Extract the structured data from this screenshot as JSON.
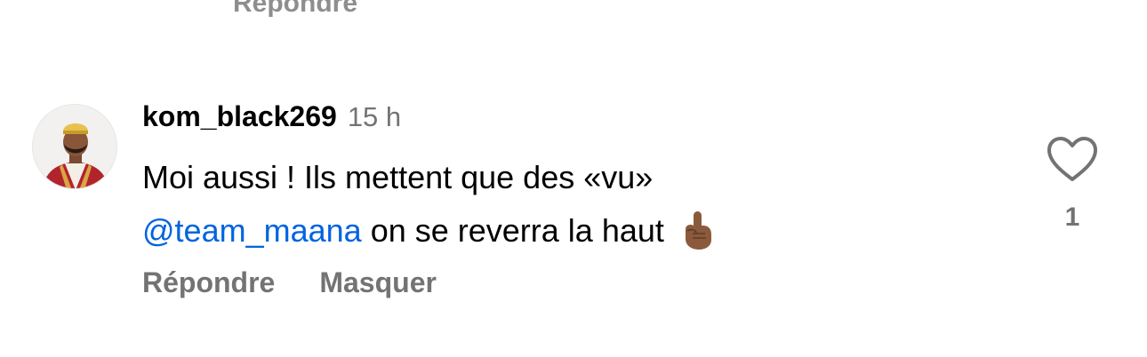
{
  "previous_comment": {
    "reply_label": "Répondre"
  },
  "comment": {
    "username": "kom_black269",
    "time_ago": "15 h",
    "text_line1": "Moi aussi ! Ils mettent que des «vu»",
    "mention": "@team_maana",
    "text_line2": "on se reverra la haut",
    "emoji": "pointing-up-emoji",
    "actions": {
      "reply_label": "Répondre",
      "hide_label": "Masquer"
    },
    "like": {
      "icon": "heart-outline-icon",
      "count": "1"
    }
  },
  "colors": {
    "text": "#000000",
    "secondary": "#737373",
    "mention": "#0064e0"
  }
}
